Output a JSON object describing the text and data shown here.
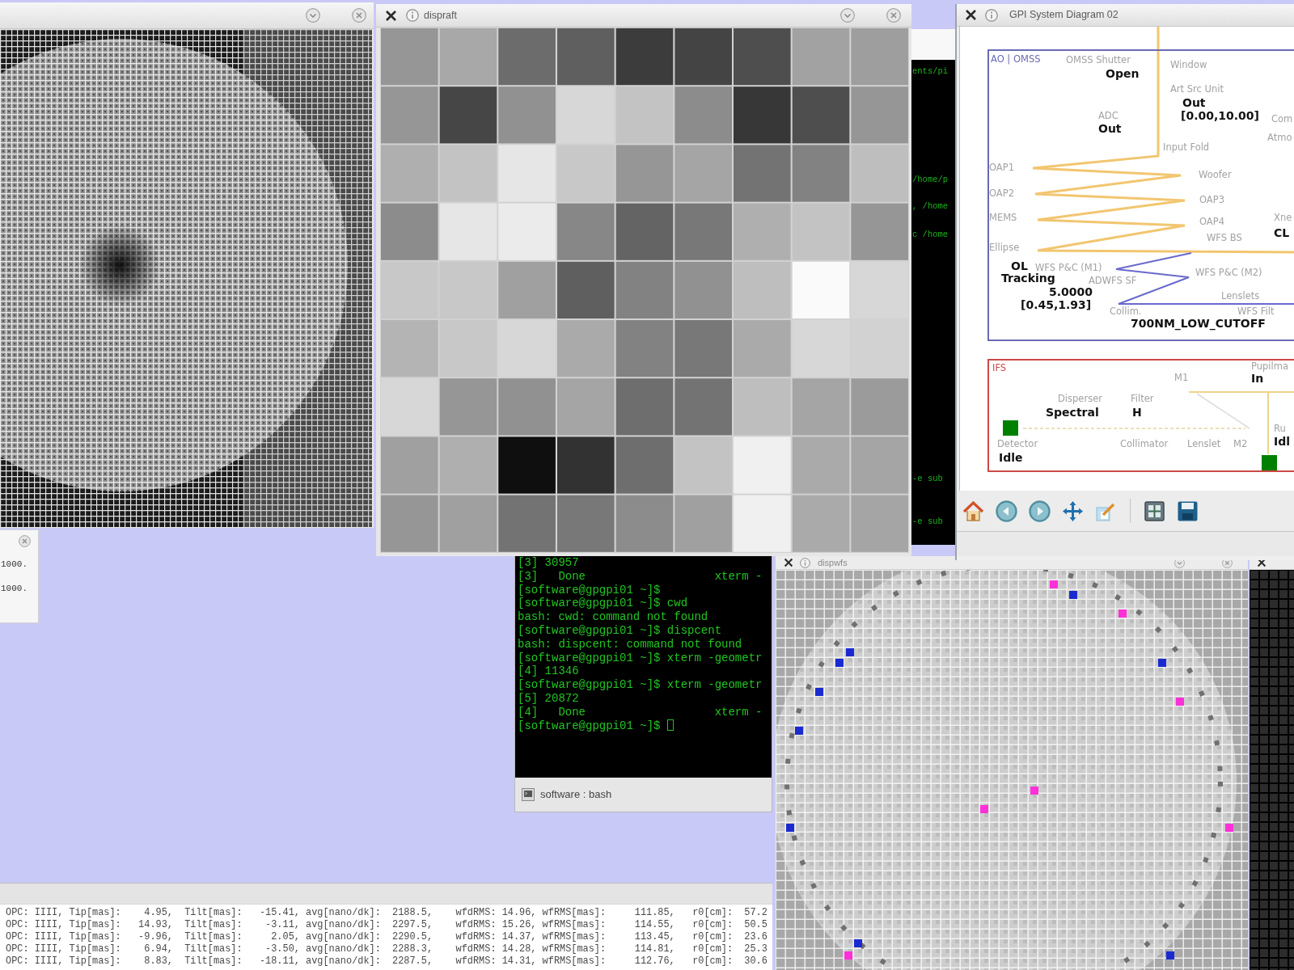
{
  "side_window": {
    "lines": [
      "1000.",
      "1000."
    ]
  },
  "image_window": {
    "title": "dispraft"
  },
  "back_terminal": {
    "lines": [
      "ents/pi",
      "/home/p",
      ", /home",
      "c /home",
      "-e sub",
      "-e sub"
    ]
  },
  "diagram_window": {
    "title": "GPI System Diagram 02",
    "sections": [
      {
        "label": "AO | OMSS",
        "color": "#6a6ab4",
        "items": [
          {
            "kind": "label",
            "text": "OMSS Shutter"
          },
          {
            "kind": "value",
            "text": "Open"
          },
          {
            "kind": "label",
            "text": "ADC"
          },
          {
            "kind": "value",
            "text": "Out"
          },
          {
            "kind": "label",
            "text": "Window"
          },
          {
            "kind": "label",
            "text": "Art Src Unit"
          },
          {
            "kind": "value",
            "text": "Out"
          },
          {
            "kind": "value",
            "text": "[0.00,10.00]"
          },
          {
            "kind": "label",
            "text": "Com"
          },
          {
            "kind": "label",
            "text": "Atmo"
          },
          {
            "kind": "label",
            "text": "Input Fold"
          },
          {
            "kind": "label",
            "text": "OAP1"
          },
          {
            "kind": "label",
            "text": "Woofer"
          },
          {
            "kind": "label",
            "text": "OAP2"
          },
          {
            "kind": "label",
            "text": "OAP3"
          },
          {
            "kind": "label",
            "text": "MEMS"
          },
          {
            "kind": "label",
            "text": "OAP4"
          },
          {
            "kind": "label",
            "text": "Xne"
          },
          {
            "kind": "value",
            "text": "CL"
          },
          {
            "kind": "label",
            "text": "WFS BS"
          },
          {
            "kind": "label",
            "text": "Ellipse"
          },
          {
            "kind": "value",
            "text": "OL"
          },
          {
            "kind": "label",
            "text": "WFS P&C (M1)"
          },
          {
            "kind": "label",
            "text": "WFS P&C (M2)"
          },
          {
            "kind": "value",
            "text": "Tracking"
          },
          {
            "kind": "label",
            "text": "ADWFS SF"
          },
          {
            "kind": "value",
            "text": "5.0000"
          },
          {
            "kind": "value",
            "text": "[0.45,1.93]"
          },
          {
            "kind": "label",
            "text": "Lenslets"
          },
          {
            "kind": "label",
            "text": "Collim."
          },
          {
            "kind": "label",
            "text": "WFS Filt"
          },
          {
            "kind": "value",
            "text": "700NM_LOW_CUTOFF"
          }
        ]
      },
      {
        "label": "IFS",
        "color": "#cc4848",
        "items": [
          {
            "kind": "label",
            "text": "M1"
          },
          {
            "kind": "label",
            "text": "Pupilma"
          },
          {
            "kind": "value",
            "text": "In"
          },
          {
            "kind": "label",
            "text": "Disperser"
          },
          {
            "kind": "value",
            "text": "Spectral"
          },
          {
            "kind": "label",
            "text": "Filter"
          },
          {
            "kind": "value",
            "text": "H"
          },
          {
            "kind": "indicator",
            "color": "#008000"
          },
          {
            "kind": "label",
            "text": "Detector"
          },
          {
            "kind": "value",
            "text": "Idle"
          },
          {
            "kind": "label",
            "text": "Collimator"
          },
          {
            "kind": "label",
            "text": "Lenslet"
          },
          {
            "kind": "label",
            "text": "M2"
          },
          {
            "kind": "label",
            "text": "Ru"
          },
          {
            "kind": "value",
            "text": "Idl"
          },
          {
            "kind": "indicator",
            "color": "#008000"
          }
        ]
      }
    ]
  },
  "terminal": {
    "lines": [
      "[3] 30957",
      "[3]   Done                   xterm -",
      "[software@gpgpi01 ~]$",
      "[software@gpgpi01 ~]$ cwd",
      "bash: cwd: command not found",
      "[software@gpgpi01 ~]$ dispcent",
      "bash: dispcent: command not found",
      "[software@gpgpi01 ~]$ xterm -geometr",
      "[4] 11346",
      "[software@gpgpi01 ~]$ xterm -geometr",
      "[5] 20872",
      "[4]   Done                   xterm -",
      "[software@gpgpi01 ~]$ "
    ],
    "tab": "software : bash"
  },
  "wfs_window": {
    "title": "dispwfs"
  },
  "log_window": {
    "lines": [
      "OPC: IIII, Tip[mas]:    4.95,  Tilt[mas]:   -15.41, avg[nano/dk]:  2188.5,    wfdRMS: 14.96, wfRMS[mas]:     111.85,   r0[cm]:  57.2",
      "OPC: IIII, Tip[mas]:   14.93,  Tilt[mas]:    -3.11, avg[nano/dk]:  2297.5,    wfdRMS: 15.26, wfRMS[mas]:     114.55,   r0[cm]:  50.5",
      "OPC: IIII, Tip[mas]:   -9.96,  Tilt[mas]:     2.05, avg[nano/dk]:  2290.5,    wfdRMS: 14.37, wfRMS[mas]:     113.45,   r0[cm]:  23.6",
      "OPC: IIII, Tip[mas]:    6.94,  Tilt[mas]:    -3.50, avg[nano/dk]:  2288.3,    wfdRMS: 14.28, wfRMS[mas]:     114.81,   r0[cm]:  25.3",
      "OPC: IIII, Tip[mas]:    8.83,  Tilt[mas]:   -18.11, avg[nano/dk]:  2287.5,    wfdRMS: 14.31, wfRMS[mas]:     112.76,   r0[cm]:  30.6"
    ]
  }
}
